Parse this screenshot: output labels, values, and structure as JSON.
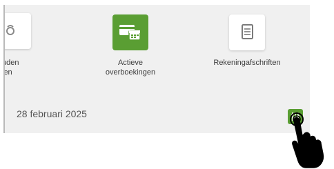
{
  "quick_actions": [
    {
      "label_line1": "uden",
      "label_line2": "jen",
      "icon": "partial-icon"
    },
    {
      "label_line1": "Actieve",
      "label_line2": "overboekingen",
      "icon": "transfers-calendar-icon"
    },
    {
      "label_line1": "Rekeningafschriften",
      "label_line2": "",
      "icon": "document-icon"
    }
  ],
  "date_header": "28 februari 2025",
  "filter_button": {
    "icon": "filter-sliders-icon"
  },
  "pointer": {
    "icon": "hand-pointer-icon"
  },
  "colors": {
    "accent_green": "#5a9e33",
    "background": "#f0f0f0",
    "text": "#3c3c3c"
  }
}
